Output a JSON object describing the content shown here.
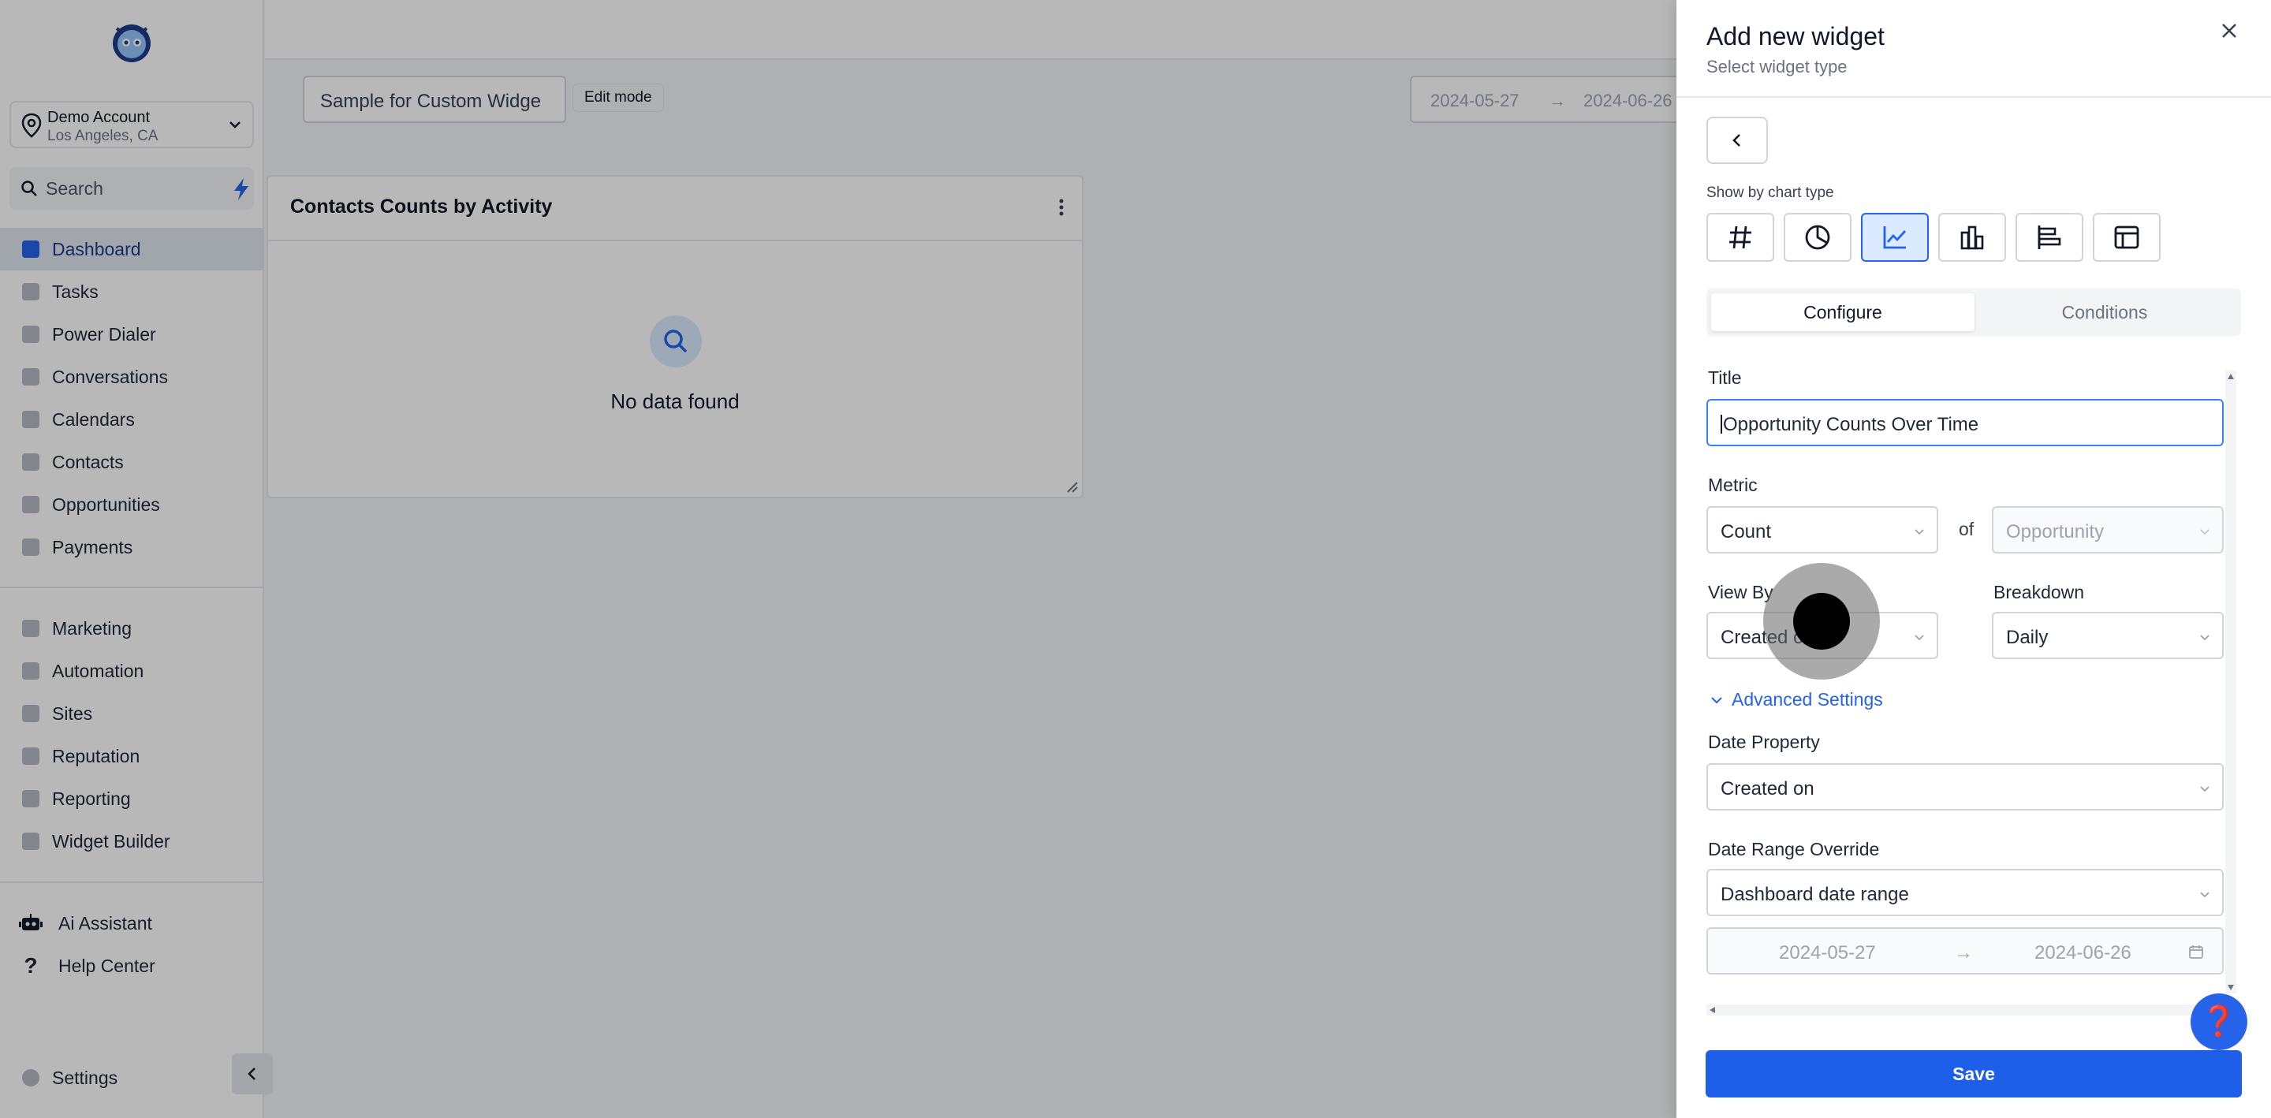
{
  "sidebar": {
    "account": {
      "name": "Demo Account",
      "location": "Los Angeles, CA"
    },
    "search_label": "Search",
    "items_main": [
      {
        "label": "Dashboard",
        "icon": "dashboard-icon"
      },
      {
        "label": "Tasks",
        "icon": "tasks-icon"
      },
      {
        "label": "Power Dialer",
        "icon": "power-dialer-icon"
      },
      {
        "label": "Conversations",
        "icon": "conversations-icon"
      },
      {
        "label": "Calendars",
        "icon": "calendar-icon"
      },
      {
        "label": "Contacts",
        "icon": "contacts-icon"
      },
      {
        "label": "Opportunities",
        "icon": "opportunities-icon"
      },
      {
        "label": "Payments",
        "icon": "payments-icon"
      }
    ],
    "items_secondary": [
      {
        "label": "Marketing",
        "icon": "marketing-icon"
      },
      {
        "label": "Automation",
        "icon": "automation-icon"
      },
      {
        "label": "Sites",
        "icon": "sites-icon"
      },
      {
        "label": "Reputation",
        "icon": "reputation-icon"
      },
      {
        "label": "Reporting",
        "icon": "reporting-icon"
      },
      {
        "label": "Widget Builder",
        "icon": "widget-builder-icon"
      }
    ],
    "items_tools": [
      {
        "label": "Ai Assistant",
        "icon": "robot-icon"
      },
      {
        "label": "Help Center",
        "icon": "question-icon"
      }
    ],
    "settings_label": "Settings",
    "active_item": "Dashboard"
  },
  "main": {
    "dashboard_name_value": "Sample for Custom Widge",
    "edit_mode_label": "Edit mode",
    "date_start": "2024-05-27",
    "date_end": "2024-06-26",
    "card": {
      "title": "Contacts Counts by Activity",
      "empty_text": "No data found"
    }
  },
  "drawer": {
    "title": "Add new widget",
    "subtitle": "Select widget type",
    "chart_type_label": "Show by chart type",
    "chart_types": [
      "number-icon",
      "pie-chart-icon",
      "line-chart-icon",
      "bar-chart-icon",
      "horizontal-bar-icon",
      "table-icon"
    ],
    "selected_chart_type": "line-chart-icon",
    "tabs": {
      "configure": "Configure",
      "conditions": "Conditions"
    },
    "form": {
      "title_label": "Title",
      "title_value": "Opportunity Counts Over Time",
      "metric_label": "Metric",
      "metric_value": "Count",
      "of_label": "of",
      "metric_object_placeholder": "Opportunity",
      "view_by_label": "View By",
      "view_by_value": "Created on",
      "breakdown_label": "Breakdown",
      "breakdown_value": "Daily",
      "advanced_label": "Advanced Settings",
      "date_property_label": "Date Property",
      "date_property_value": "Created on",
      "date_range_override_label": "Date Range Override",
      "date_range_override_value": "Dashboard date range",
      "override_start": "2024-05-27",
      "override_end": "2024-06-26"
    },
    "save_label": "Save",
    "help_glyph": "❓"
  },
  "colors": {
    "primary": "#1d5fe8",
    "accent_light": "#dbeafe",
    "overlay": "rgba(0,0,0,0.28)"
  }
}
